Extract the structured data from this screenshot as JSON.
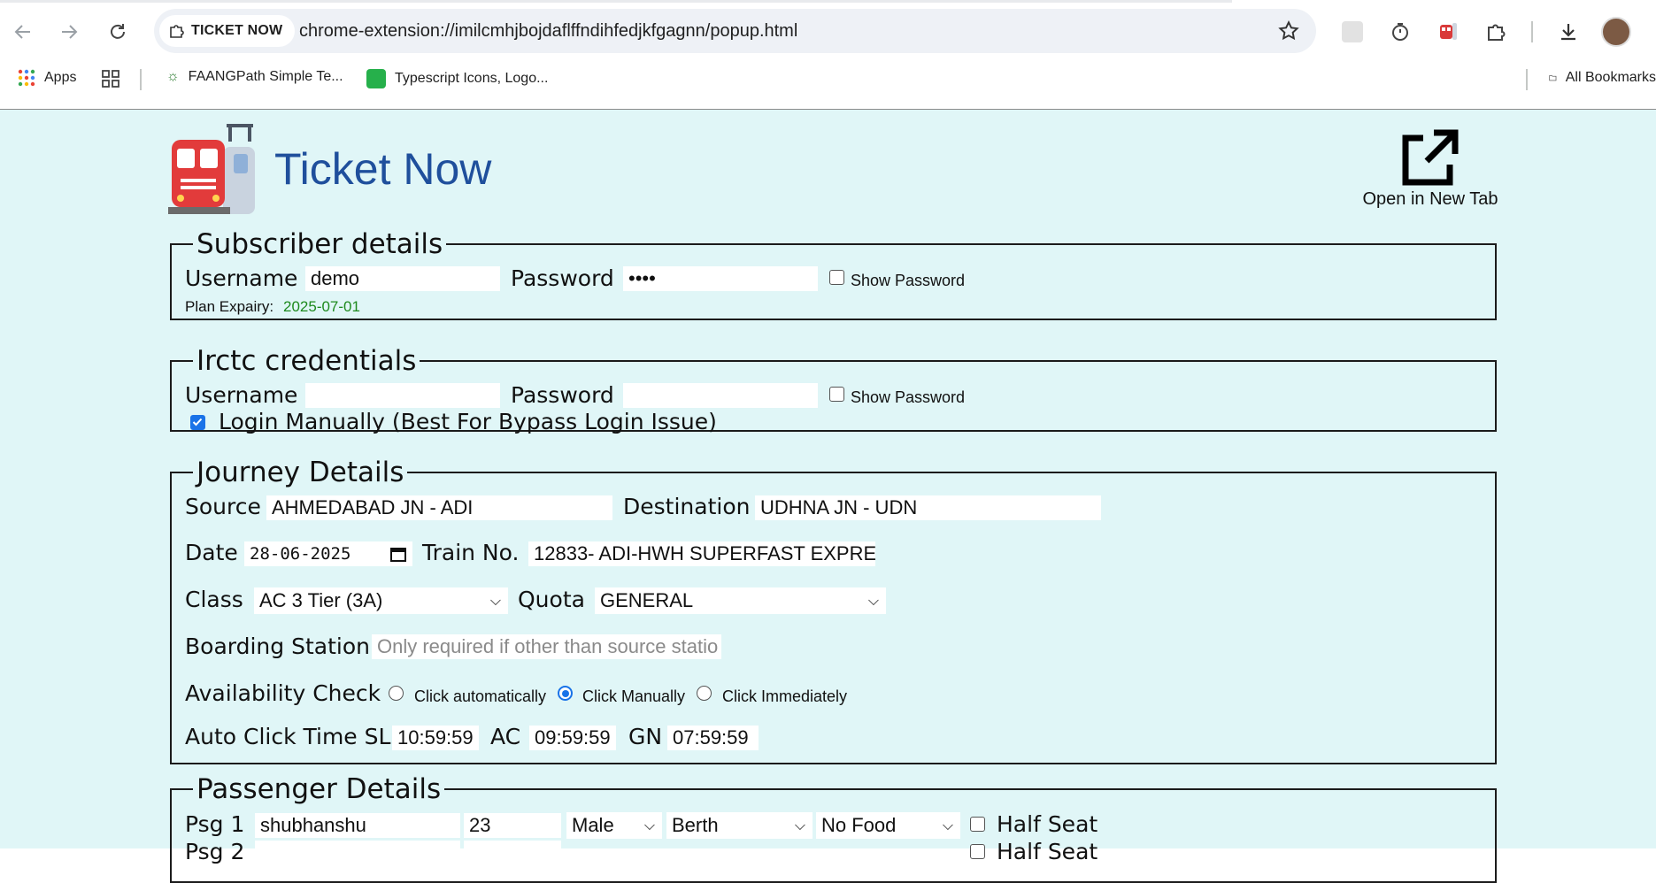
{
  "browser": {
    "site_chip": "TICKET NOW",
    "url": "chrome-extension://imilcmhjbojdaflffndihfedjkfgagnn/popup.html",
    "bookmarks": [
      {
        "label": "Apps"
      },
      {
        "label": "FAANGPath Simple Te..."
      },
      {
        "label": "Typescript Icons, Logo..."
      }
    ],
    "all_bookmarks": "All Bookmarks"
  },
  "header": {
    "title": "Ticket Now",
    "open_new_tab": "Open in New Tab"
  },
  "subscriber": {
    "legend": "Subscriber details",
    "username_label": "Username",
    "username_value": "demo",
    "password_label": "Password",
    "password_value": "••••",
    "show_password": "Show Password",
    "plan_label": "Plan Expairy:",
    "plan_value": "2025-07-01"
  },
  "irctc": {
    "legend": "Irctc credentials",
    "username_label": "Username",
    "username_value": "",
    "password_label": "Password",
    "password_value": "",
    "show_password": "Show Password",
    "login_manually": "Login Manually (Best For Bypass Login Issue)"
  },
  "journey": {
    "legend": "Journey Details",
    "source_label": "Source",
    "source_value": "AHMEDABAD JN - ADI",
    "destination_label": "Destination",
    "destination_value": "UDHNA JN - UDN",
    "date_label": "Date",
    "date_value": "28-06-2025",
    "train_label": "Train No.",
    "train_value": "12833- ADI-HWH SUPERFAST EXPRE",
    "class_label": "Class",
    "class_value": "AC 3 Tier (3A)",
    "quota_label": "Quota",
    "quota_value": "GENERAL",
    "boarding_label": "Boarding Station",
    "boarding_placeholder": "Only required if other than source statio",
    "availability_label": "Availability Check",
    "opt_auto": "Click automatically",
    "opt_manual": "Click Manually",
    "opt_immediate": "Click Immediately",
    "autoclick_label": "Auto Click Time SL",
    "sl_value": "10:59:59",
    "ac_label": "AC",
    "ac_value": "09:59:59",
    "gn_label": "GN",
    "gn_value": "07:59:59"
  },
  "passengers": {
    "legend": "Passenger Details",
    "rows": [
      {
        "label": "Psg 1",
        "name": "shubhanshu",
        "age": "23",
        "gender": "Male",
        "berth": "Berth",
        "food": "No Food",
        "half_seat": "Half Seat"
      },
      {
        "label": "Psg 2",
        "name": "",
        "age": "",
        "gender": "",
        "berth": "",
        "food": "",
        "half_seat": "Half Seat"
      }
    ]
  },
  "colors": {
    "page_bg": "#e0f6f7",
    "title": "#1f4f9c",
    "plan_value": "#1e8a1e",
    "accent": "#1a73e8"
  }
}
